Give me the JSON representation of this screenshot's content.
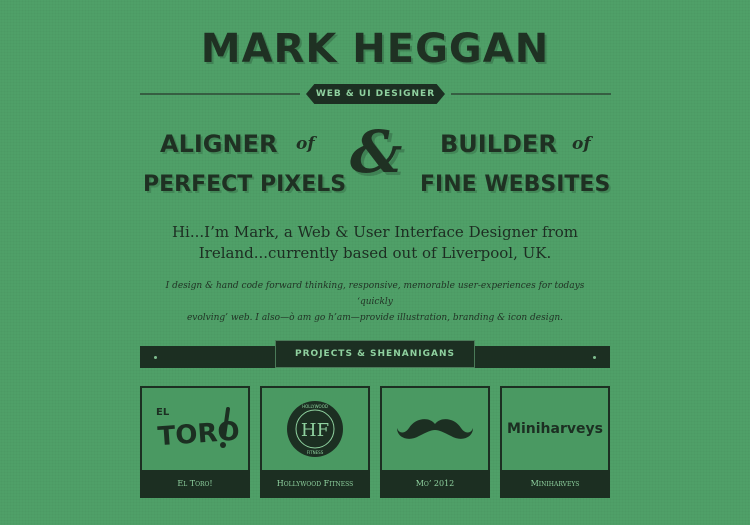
{
  "header": {
    "name": "MARK HEGGAN",
    "role_badge": "WEB & UI DESIGNER"
  },
  "tagline": {
    "left_line1": "ALIGNER",
    "left_of": "of",
    "left_line2": "PERFECT PIXELS",
    "ampersand": "&",
    "right_line1": "BUILDER",
    "right_of": "of",
    "right_line2": "FINE WEBSITES"
  },
  "intro": {
    "line1": "Hi...I’m Mark, a Web & User Interface Designer from",
    "line2": "Ireland...currently based out of Liverpool, UK."
  },
  "description": {
    "line1": "I design & hand code forward thinking, responsive, memorable user-experiences for todays ‘quickly",
    "line2": "evolving’ web. I also—ò am go h’am—provide illustration, branding & icon design."
  },
  "projects": {
    "heading": "PROJECTS & SHENANIGANS",
    "items": [
      {
        "caption": "El Toro!",
        "art_text": "EL TORO!"
      },
      {
        "caption": "Hollywood Fitness",
        "art_text": "HF",
        "art_ring_top": "HOLLYWOOD",
        "art_ring_bottom": "FITNESS"
      },
      {
        "caption": "Mo’ 2012",
        "art_icon": "mustache-icon"
      },
      {
        "caption": "Miniharveys",
        "art_text": "Miniharveys"
      }
    ]
  },
  "colors": {
    "background": "#4fa068",
    "dark": "#1c2f22",
    "light_text": "#8fd19f"
  }
}
